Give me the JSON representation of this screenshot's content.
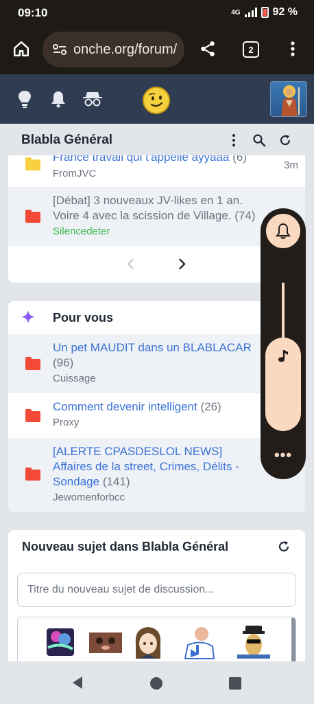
{
  "status_bar": {
    "time": "09:10",
    "network": "4G",
    "battery": "92 %"
  },
  "browser": {
    "url": "onche.org/forum/",
    "tab_count": "2"
  },
  "forum_header": {
    "title": "Blabla Général"
  },
  "topics_top": [
    {
      "title": "France travail qui t'appelle ayyaaa",
      "count": "(6)",
      "author": "FromJVC",
      "ago": "3m",
      "folder_color": "#f7d13e"
    },
    {
      "title": "[Débat] 3 nouveaux JV-likes en 1 an. Voire 4 avec la scission de Village.",
      "count": "(74)",
      "author": "Silencedeter",
      "folder_color": "#f24a36"
    }
  ],
  "pour_vous": {
    "title": "Pour vous",
    "topics": [
      {
        "title": "Un pet MAUDIT dans un BLABLACAR",
        "count": "(96)",
        "author": "Cuissage"
      },
      {
        "title": "Comment devenir intelligent",
        "count": "(26)",
        "author": "Proxy"
      },
      {
        "title": "[ALERTE CPASDESLOL NEWS] Affaires de la street, Crimes, Délits - Sondage",
        "count": "(141)",
        "author": "Jewomenforbcc"
      }
    ]
  },
  "new_topic": {
    "title": "Nouveau sujet dans Blabla Général",
    "placeholder": "Titre du nouveau sujet de discussion...",
    "stickers": [
      "booster-sticker",
      "cat-sticker",
      "anime-girl-sticker",
      "man-flag-sticker",
      "peanut-sticker"
    ]
  },
  "volume_panel": {
    "level": 0.55
  }
}
